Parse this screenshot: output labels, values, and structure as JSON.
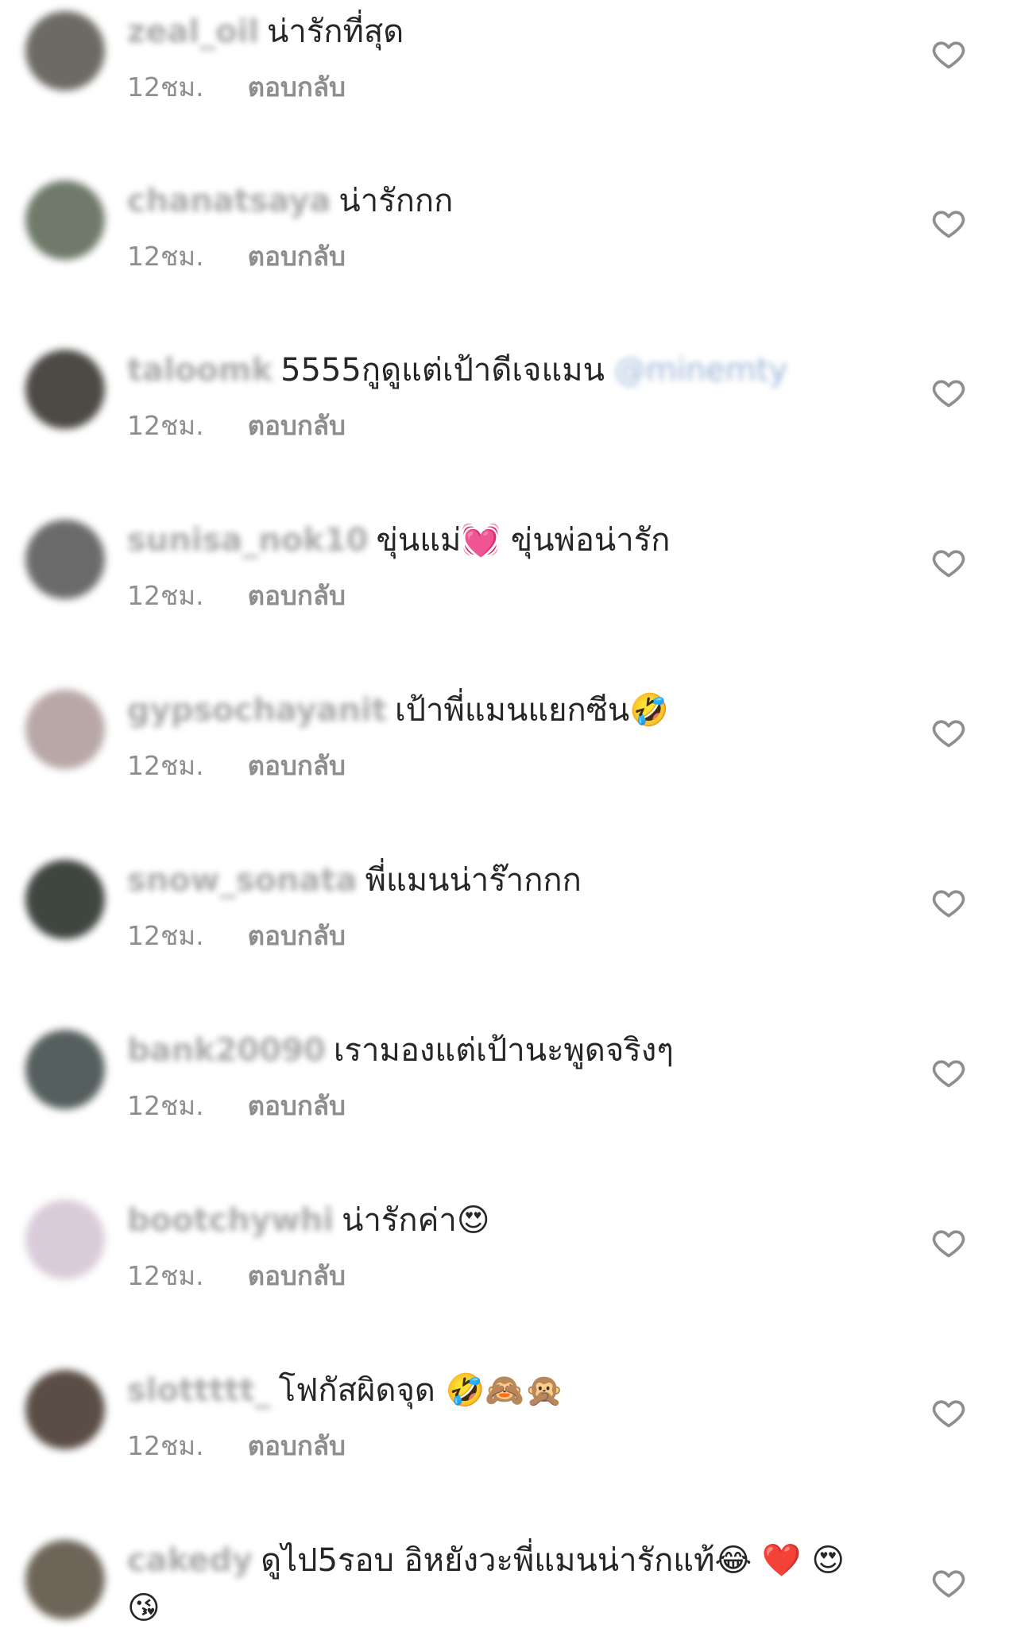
{
  "comments": [
    {
      "username": "zeal_oil",
      "text": "น่ารักที่สุด",
      "time": "12ชม.",
      "reply": "ตอบกลับ",
      "avatar_color": "#6c6a63"
    },
    {
      "username": "chanatsaya",
      "text": "น่ารักกก",
      "time": "12ชม.",
      "reply": "ตอบกลับ",
      "avatar_color": "#6f7a6a"
    },
    {
      "username": "taloomk",
      "text": "5555กูดูแต่เป้าดีเจแมน",
      "mention": "@minemty",
      "time": "12ชม.",
      "reply": "ตอบกลับ",
      "avatar_color": "#4d4a45"
    },
    {
      "username": "sunisa_nok10",
      "text": "ขุ่นแม่💓 ขุ่นพ่อน่ารัก",
      "time": "12ชม.",
      "reply": "ตอบกลับ",
      "avatar_color": "#6b6b6b"
    },
    {
      "username": "gypsochayanit",
      "text": "เป้าพี่แมนแยกซีน🤣",
      "time": "12ชม.",
      "reply": "ตอบกลับ",
      "avatar_color": "#b8a7a6"
    },
    {
      "username": "snow_sonata",
      "text": "พี่แมนน่าร๊ากกก",
      "time": "12ชม.",
      "reply": "ตอบกลับ",
      "avatar_color": "#3f4540"
    },
    {
      "username": "bank20090",
      "text": "เรามองแต่เป้านะพูดจริงๆ",
      "time": "12ชม.",
      "reply": "ตอบกลับ",
      "avatar_color": "#55605e"
    },
    {
      "username": "bootchywhi",
      "text": "น่ารักค่า😍",
      "time": "12ชม.",
      "reply": "ตอบกลับ",
      "avatar_color": "#d9ccd8"
    },
    {
      "username": "slottttt_",
      "text": "โฟกัสผิดจุด 🤣🙈🙊",
      "time": "12ชม.",
      "reply": "ตอบกลับ",
      "avatar_color": "#5a4d45"
    },
    {
      "username": "cakedy",
      "text": "ดูไป5รอบ อิหยังวะพี่แมนน่ารักแท้😂 ❤️ 😍",
      "continuation": "😘",
      "time": "",
      "reply": "",
      "avatar_color": "#6d6558"
    }
  ],
  "colors": {
    "username": "#a9a9a9",
    "text": "#262626",
    "meta": "#8e8e8e",
    "heart": "#8e8e8e"
  },
  "icons": {
    "like": "heart-outline-icon"
  }
}
